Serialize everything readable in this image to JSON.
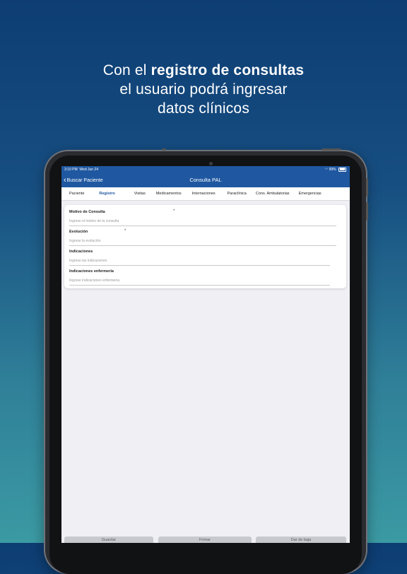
{
  "headline": {
    "line1_prefix": "Con el ",
    "line1_bold": "registro de consultas",
    "line2": "el usuario podrá ingresar",
    "line3": "datos clínicos"
  },
  "status_bar": {
    "time": "3:10 PM",
    "date": "Wed Jun 24",
    "battery": "99%"
  },
  "nav": {
    "back_label": "Buscar Paciente",
    "title": "Consulta PAL"
  },
  "tabs": [
    {
      "label": "Paciente",
      "active": false
    },
    {
      "label": "Registro",
      "active": true
    },
    {
      "label": "Visitas",
      "active": false
    },
    {
      "label": "Medicamentos",
      "active": false
    },
    {
      "label": "Internaciones",
      "active": false
    },
    {
      "label": "Paraclínica",
      "active": false
    },
    {
      "label": "Cons. Ambulatorias",
      "active": false
    },
    {
      "label": "Emergencias",
      "active": false
    }
  ],
  "form": {
    "fields": [
      {
        "label": "Motivo de Consulta",
        "required_mark": "*",
        "placeholder": "Ingrese el motivo de la consulta"
      },
      {
        "label": "Evolución",
        "required_mark": "*",
        "placeholder": "Ingrese la evolución"
      },
      {
        "label": "Indicaciones",
        "required_mark": "",
        "placeholder": "Ingrese las indicaciones"
      },
      {
        "label": "Indicaciones enfermería",
        "required_mark": "",
        "placeholder": "Ingrese indicaciones enfermería"
      }
    ]
  },
  "footer": {
    "save_label": "Guardar",
    "sign_label": "Firmar",
    "discharge_label": "Dar de baja"
  },
  "colors": {
    "brand": "#1f58a1",
    "screen_bg": "#efeff4"
  }
}
